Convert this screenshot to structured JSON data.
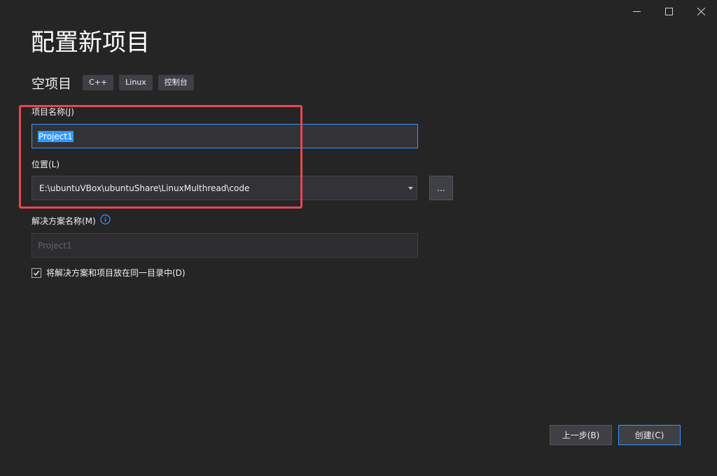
{
  "window_controls": {
    "minimize_icon": "minimize-icon",
    "maximize_icon": "maximize-icon",
    "close_icon": "close-icon"
  },
  "page": {
    "title": "配置新项目"
  },
  "template": {
    "name": "空项目",
    "tags": [
      "C++",
      "Linux",
      "控制台"
    ]
  },
  "project_name": {
    "label": "项目名称(J)",
    "value": "Project1"
  },
  "location": {
    "label": "位置(L)",
    "value": "E:\\ubuntuVBox\\ubuntuShare\\LinuxMulthread\\code",
    "browse_label": "..."
  },
  "solution_name": {
    "label": "解决方案名称(M)",
    "placeholder": "Project1"
  },
  "same_directory": {
    "label": "将解决方案和项目放在同一目录中(D)",
    "checked": true
  },
  "footer": {
    "back_label": "上一步(B)",
    "create_label": "创建(C)"
  },
  "colors": {
    "background": "#252526",
    "input_background": "#333337",
    "accent": "#3399ff",
    "highlight_annotation": "#e8484f"
  }
}
